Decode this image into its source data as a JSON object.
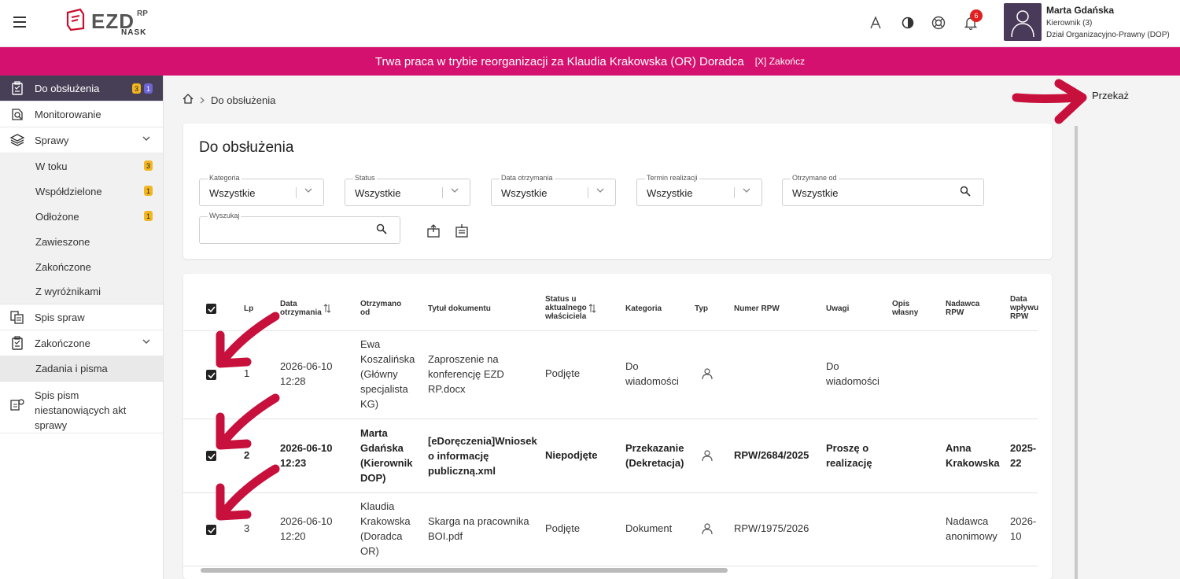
{
  "header": {
    "logo_text": "EZD",
    "logo_sup": "RP",
    "logo_sub": "NASK",
    "notifications_count": "6",
    "user": {
      "name": "Marta Gdańska",
      "role": "Kierownik (3)",
      "department": "Dział Organizacyjno-Prawny (DOP)"
    }
  },
  "banner": {
    "text": "Trwa praca w trybie reorganizacji za Klaudia Krakowska (OR) Doradca",
    "end_label": "[X] Zakończ",
    "color": "#d4116e"
  },
  "sidebar": {
    "do_obsluzenia": {
      "label": "Do obsłużenia",
      "badge_yellow": "3",
      "badge_purple": "1"
    },
    "monitorowanie": "Monitorowanie",
    "sprawy": "Sprawy",
    "sprawy_sub": [
      {
        "label": "W toku",
        "badge": "3"
      },
      {
        "label": "Współdzielone",
        "badge": "1"
      },
      {
        "label": "Odłożone",
        "badge": "1"
      },
      {
        "label": "Zawieszone",
        "badge": ""
      },
      {
        "label": "Zakończone",
        "badge": ""
      },
      {
        "label": "Z wyróżnikami",
        "badge": ""
      }
    ],
    "spis_spraw": "Spis spraw",
    "zakonczone": "Zakończone",
    "zadania_i_pisma": "Zadania i pisma",
    "spis_pism_1": "Spis pism",
    "spis_pism_2": "niestanowiących akt",
    "spis_pism_3": "sprawy"
  },
  "breadcrumb": {
    "current": "Do obsłużenia"
  },
  "actions": {
    "przekaz": "Przekaż"
  },
  "filters": {
    "title": "Do obsłużenia",
    "kategoria": {
      "label": "Kategoria",
      "value": "Wszystkie"
    },
    "status": {
      "label": "Status",
      "value": "Wszystkie"
    },
    "data_otrzymania": {
      "label": "Data otrzymania",
      "value": "Wszystkie"
    },
    "termin_realizacji": {
      "label": "Termin realizacji",
      "value": "Wszystkie"
    },
    "otrzymane_od": {
      "label": "Otrzymane od",
      "value": "Wszystkie"
    },
    "wyszukaj": {
      "label": "Wyszukaj",
      "value": ""
    }
  },
  "table": {
    "headers": {
      "lp": "Lp",
      "data_otrzymania_1": "Data",
      "data_otrzymania_2": "otrzymania",
      "otrzymano_od_1": "Otrzymano",
      "otrzymano_od_2": "od",
      "tytul": "Tytuł dokumentu",
      "status_1": "Status u",
      "status_2": "aktualnego",
      "status_3": "właściciela",
      "kategoria": "Kategoria",
      "typ": "Typ",
      "numer_rpw": "Numer RPW",
      "uwagi": "Uwagi",
      "opis_1": "Opis",
      "opis_2": "własny",
      "nadawca_1": "Nadawca",
      "nadawca_2": "RPW",
      "data_wplywu_1": "Data",
      "data_wplywu_2": "wpływu",
      "data_wplywu_3": "RPW"
    },
    "rows": [
      {
        "lp": "1",
        "date_1": "2026-06-10",
        "date_2": "12:28",
        "from_1": "Ewa",
        "from_2": "Koszalińska",
        "from_3": "(Główny",
        "from_4": "specjalista",
        "from_5": "KG)",
        "title_1": "Zaproszenie na",
        "title_2": "konferencję EZD",
        "title_3": "RP.docx",
        "status": "Podjęte",
        "category_1": "Do",
        "category_2": "wiadomości",
        "rpw": "",
        "notes_1": "Do",
        "notes_2": "wiadomości",
        "sender_1": "",
        "sender_2": "",
        "rpw_date_1": "",
        "rpw_date_2": ""
      },
      {
        "lp": "2",
        "date_1": "2026-06-10",
        "date_2": "12:23",
        "from_1": "Marta",
        "from_2": "Gdańska",
        "from_3": "(Kierownik",
        "from_4": "DOP)",
        "title_1": "[eDoręczenia]Wniosek",
        "title_2": "o informację",
        "title_3": "publiczną.xml",
        "status": "Niepodjęte",
        "category_1": "Przekazanie",
        "category_2": "(Dekretacja)",
        "rpw": "RPW/2684/2025",
        "notes_1": "Proszę o",
        "notes_2": "realizację",
        "sender_1": "Anna",
        "sender_2": "Krakowska",
        "rpw_date_1": "2025-",
        "rpw_date_2": "22"
      },
      {
        "lp": "3",
        "date_1": "2026-06-10",
        "date_2": "12:20",
        "from_1": "Klaudia",
        "from_2": "Krakowska",
        "from_3": "(Doradca",
        "from_4": "OR)",
        "title_1": "Skarga na pracownika",
        "title_2": "BOI.pdf",
        "status": "Podjęte",
        "category_1": "Dokument",
        "rpw": "RPW/1975/2026",
        "notes_1": "",
        "sender_1": "Nadawca",
        "sender_2": "anonimowy",
        "rpw_date_1": "2026-",
        "rpw_date_2": "10"
      }
    ]
  },
  "colors": {
    "accent": "#d4116e",
    "sidebar_active": "#473f56",
    "badge_yellow": "#f2b620",
    "badge_purple": "#6d64d6",
    "arrow": "#c8103c"
  }
}
